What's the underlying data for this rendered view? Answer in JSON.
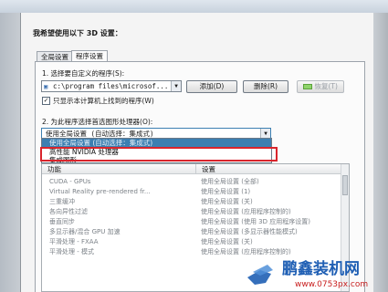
{
  "heading": "我希望使用以下 3D 设置：",
  "tabs": [
    {
      "label": "全局设置",
      "active": false
    },
    {
      "label": "程序设置",
      "active": true
    }
  ],
  "step1_label": "1. 选择要自定义的程序(S):",
  "program_combo_value": "c:\\program files\\microsof...",
  "add_button": "添加(D)",
  "remove_button": "删除(R)",
  "restore_button": "恢复(T)",
  "checkbox_label": "只显示本计算机上找到的程序(W)",
  "checkbox_checked": true,
  "step2_label": "2. 为此程序选择首选图形处理器(O):",
  "gpu_combo_value": "使用全局设置 (自动选择：集成式)",
  "gpu_options": [
    "使用全局设置 (自动选择：集成式)",
    "高性能 NVIDIA 处理器",
    "集成图形"
  ],
  "table": {
    "headers": [
      "功能",
      "设置"
    ],
    "rows": [
      [
        "CUDA - GPUs",
        "使用全局设置 (全部)"
      ],
      [
        "Virtual Reality pre-rendered fr...",
        "使用全局设置 (1)"
      ],
      [
        "三重缓冲",
        "使用全局设置 (关)"
      ],
      [
        "各向异性过滤",
        "使用全局设置 (应用程序控制的)"
      ],
      [
        "垂直同步",
        "使用全局设置 (使用 3D 应用程序设置)"
      ],
      [
        "多显示器/混合 GPU 加速",
        "使用全局设置 (多显示器性能模式)"
      ],
      [
        "平滑处理 - FXAA",
        "使用全局设置 (关)"
      ],
      [
        "平滑处理 - 模式",
        "使用全局设置 (应用程序控制的)"
      ]
    ]
  },
  "watermark": {
    "brand": "鹏鑫装机网",
    "url": "www.0753px.com"
  },
  "colors": {
    "highlight_box": "#d9242c",
    "selection": "#3c7fb1",
    "brand_blue": "#1f5fb4"
  }
}
